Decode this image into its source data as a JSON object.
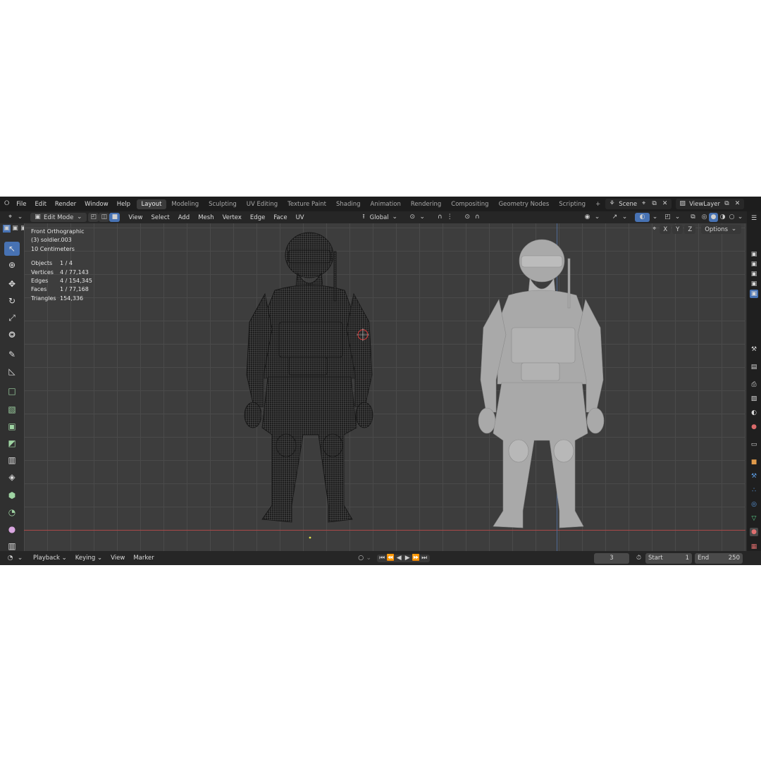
{
  "menu": [
    "File",
    "Edit",
    "Render",
    "Window",
    "Help"
  ],
  "workspaces": [
    "Layout",
    "Modeling",
    "Sculpting",
    "UV Editing",
    "Texture Paint",
    "Shading",
    "Animation",
    "Rendering",
    "Compositing",
    "Geometry Nodes",
    "Scripting"
  ],
  "active_workspace": "Layout",
  "add_workspace_label": "+",
  "scene": {
    "value": "Scene"
  },
  "view_layer": {
    "value": "ViewLayer"
  },
  "header": {
    "mode": "Edit Mode",
    "menus": [
      "View",
      "Select",
      "Add",
      "Mesh",
      "Vertex",
      "Edge",
      "Face",
      "UV"
    ],
    "transform_orientation": "Global",
    "options_label": "Options",
    "axes": [
      "X",
      "Y",
      "Z"
    ]
  },
  "overlay_info": {
    "view_name": "Front Orthographic",
    "object_name": "(3) soldier.003",
    "grid_scale": "10 Centimeters"
  },
  "stats": [
    {
      "label": "Objects",
      "value": "1 / 4"
    },
    {
      "label": "Vertices",
      "value": "4 / 77,143"
    },
    {
      "label": "Edges",
      "value": "4 / 154,345"
    },
    {
      "label": "Faces",
      "value": "1 / 77,168"
    },
    {
      "label": "Triangles",
      "value": "154,336"
    }
  ],
  "timeline": {
    "menus": [
      "Playback",
      "Keying",
      "View",
      "Marker"
    ],
    "current_frame": "3",
    "start_label": "Start",
    "start_value": "1",
    "end_label": "End",
    "end_value": "250"
  },
  "colors": {
    "accent": "#4772b3",
    "background": "#303030",
    "viewport": "#3d3d3d",
    "frame_line": "#c34747"
  }
}
